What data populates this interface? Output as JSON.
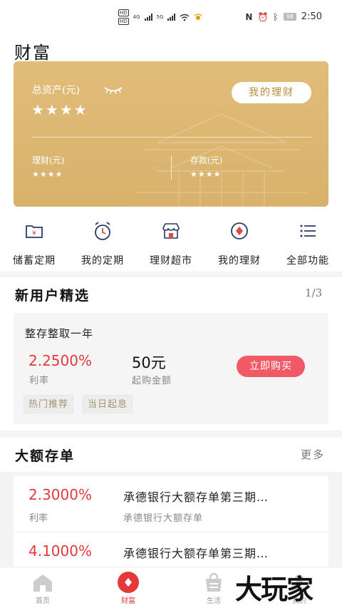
{
  "status_bar": {
    "left_hd_1": "HD",
    "left_hd_2": "HD",
    "net_1": "4G",
    "net_2": "5G",
    "battery": "98",
    "time": "2:50"
  },
  "page_title": "财富",
  "asset_card": {
    "total_label": "总资产(元)",
    "total_value": "★★★★",
    "my_finance_button": "我的理财",
    "finance_label": "理财(元)",
    "finance_value": "★★★★",
    "deposit_label": "存款(元)",
    "deposit_value": "★★★★"
  },
  "quick_actions": [
    {
      "label": "储蓄定期",
      "icon": "folder-yuan-icon"
    },
    {
      "label": "我的定期",
      "icon": "alarm-clock-icon"
    },
    {
      "label": "理财超市",
      "icon": "store-icon"
    },
    {
      "label": "我的理财",
      "icon": "wealth-diamond-icon"
    },
    {
      "label": "全部功能",
      "icon": "list-icon"
    }
  ],
  "new_user": {
    "title": "新用户精选",
    "pager": "1/3",
    "product": {
      "name": "整存整取一年",
      "rate": "2.2500%",
      "rate_label": "利率",
      "amount": "50元",
      "amount_label": "起购金额",
      "buy_button": "立即购买",
      "tags": [
        "热门推荐",
        "当日起息"
      ]
    }
  },
  "cd": {
    "title": "大额存单",
    "more": "更多",
    "items": [
      {
        "rate": "2.3000%",
        "rate_label": "利率",
        "title": "承德银行大额存单第三期…",
        "desc": "承德银行大额存单"
      },
      {
        "rate": "4.1000%",
        "rate_label": "",
        "title": "承德银行大额存单第三期…",
        "desc": ""
      }
    ]
  },
  "tabbar": [
    {
      "label": "首页",
      "icon": "home-icon",
      "active": false
    },
    {
      "label": "财富",
      "icon": "wealth-icon",
      "active": true
    },
    {
      "label": "生活",
      "icon": "life-bag-icon",
      "active": false
    },
    {
      "label": "我的",
      "icon": "profile-icon",
      "active": false
    }
  ],
  "watermark": "大玩家",
  "colors": {
    "card_gold": "#d8b26b",
    "accent_red": "#e5383b",
    "buy_button": "#ef5a66",
    "tag_text": "#a39371"
  }
}
